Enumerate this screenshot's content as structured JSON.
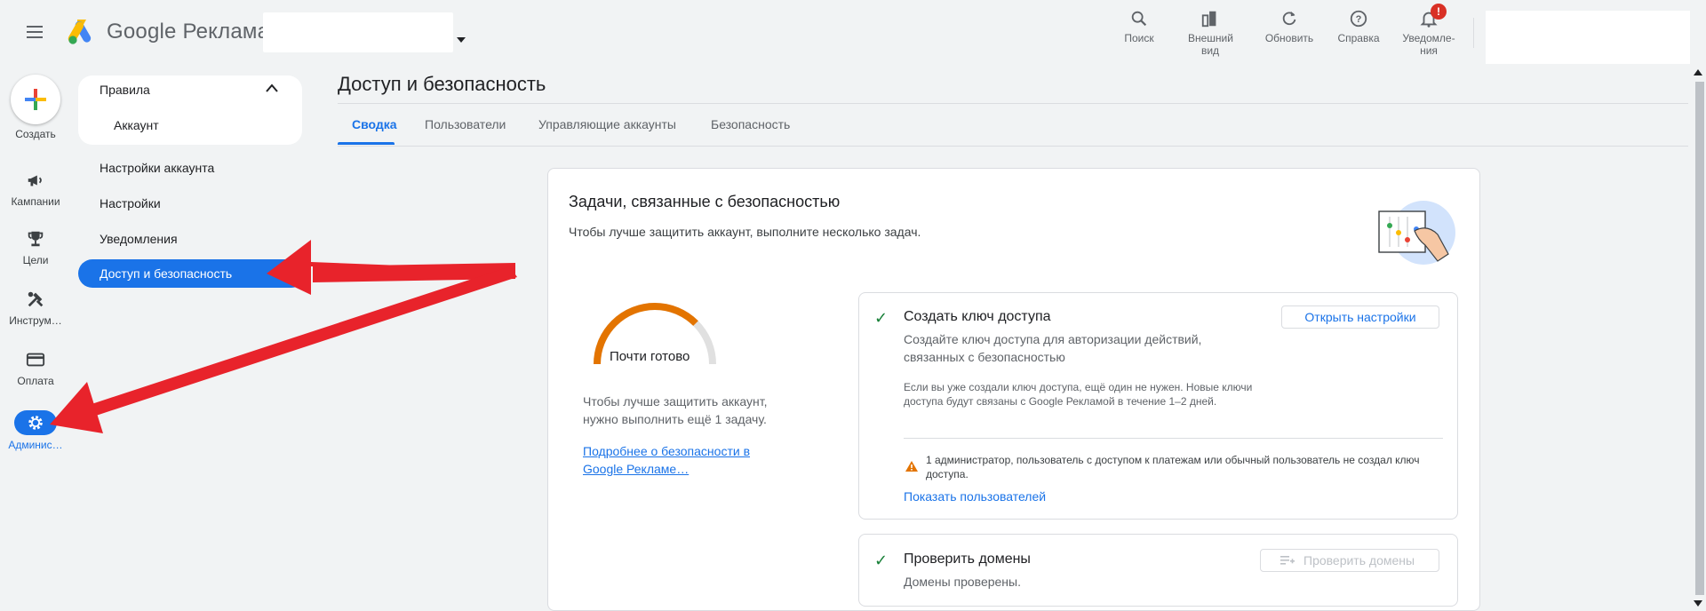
{
  "header": {
    "brand": "Google Реклама",
    "tools": [
      {
        "label": "Поиск",
        "icon": "search-icon"
      },
      {
        "label": "Внешний вид",
        "icon": "appearance-icon"
      },
      {
        "label": "Обновить",
        "icon": "refresh-icon"
      },
      {
        "label": "Справка",
        "icon": "help-icon"
      },
      {
        "label": "Уведомле-ния",
        "icon": "bell-icon",
        "badge": "!"
      }
    ]
  },
  "rail": {
    "create": "Создать",
    "items": [
      {
        "label": "Кампании",
        "icon": "megaphone-icon"
      },
      {
        "label": "Цели",
        "icon": "trophy-icon"
      },
      {
        "label": "Инструм…",
        "icon": "tools-icon"
      },
      {
        "label": "Оплата",
        "icon": "credit-card-icon"
      },
      {
        "label": "Админис…",
        "icon": "gear-icon"
      }
    ]
  },
  "nav": {
    "group_title": "Правила",
    "group_child": "Аккаунт",
    "items": [
      "Настройки аккаунта",
      "Настройки",
      "Уведомления"
    ],
    "active": "Доступ и безопасность"
  },
  "page": {
    "title": "Доступ и безопасность",
    "tabs": [
      "Сводка",
      "Пользователи",
      "Управляющие аккаунты",
      "Безопасность"
    ]
  },
  "card": {
    "title": "Задачи, связанные с безопасностью",
    "subtitle": "Чтобы лучше защитить аккаунт, выполните несколько задач.",
    "gauge_label": "Почти готово",
    "gauge_progress": 0.75,
    "gauge_desc": "Чтобы лучше защитить аккаунт, нужно выполнить ещё 1 задачу.",
    "gauge_link": "Подробнее о безопасности в Google Рекламе…",
    "task1": {
      "title": "Создать ключ доступа",
      "desc": "Создайте ключ доступа для авторизации действий, связанных с безопасностью",
      "button": "Открыть настройки",
      "note": "Если вы уже создали ключ доступа, ещё один не нужен. Новые ключи доступа будут связаны с Google Рекламой в течение 1–2 дней.",
      "warning": "1 администратор, пользователь с доступом к платежам или обычный пользователь не создал ключ доступа.",
      "link": "Показать пользователей"
    },
    "task2": {
      "title": "Проверить домены",
      "desc": "Домены проверены.",
      "button": "Проверить домены"
    }
  },
  "colors": {
    "accent": "#1a73e8",
    "gauge": "#e37400",
    "success": "#188038",
    "warning": "#e37400",
    "annotation_arrow": "#e8232b"
  }
}
